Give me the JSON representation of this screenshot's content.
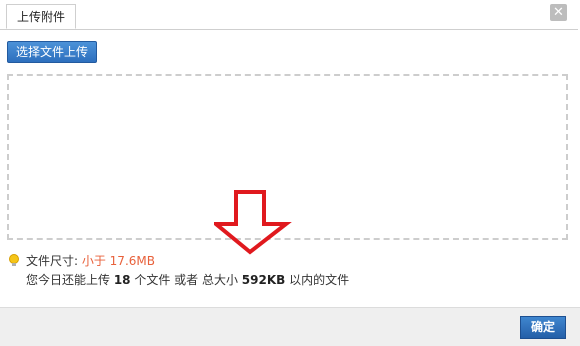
{
  "dialog": {
    "tab_label": "上传附件",
    "close_glyph": "✕"
  },
  "upload": {
    "button_label": "选择文件上传"
  },
  "info": {
    "size_label": "文件尺寸: ",
    "size_limit": "小于 17.6MB",
    "quota_prefix": "您今日还能上传 ",
    "file_count": "18",
    "quota_mid": " 个文件 或者 总大小 ",
    "total_size": "592KB",
    "quota_suffix": " 以内的文件"
  },
  "footer": {
    "ok_label": "确定"
  },
  "colors": {
    "accent": "#2d6fbe",
    "limit_text": "#e8613b",
    "arrow": "#e0191e"
  },
  "icons": [
    "close-icon",
    "lightbulb-icon",
    "down-arrow-annotation"
  ]
}
